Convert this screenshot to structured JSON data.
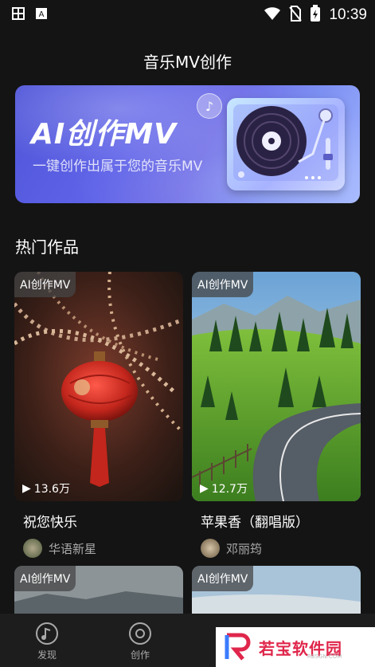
{
  "status_bar": {
    "time": "10:39",
    "icons": [
      "app-icon",
      "text-a-icon",
      "wifi-icon",
      "no-sim-icon",
      "battery-charging-icon"
    ]
  },
  "header": {
    "title": "音乐MV创作"
  },
  "banner": {
    "title": "AI创作MV",
    "subtitle": "一键创作出属于您的音乐MV"
  },
  "section": {
    "title": "热门作品"
  },
  "works": [
    {
      "tag": "AI创作MV",
      "plays": "13.6万",
      "song": "祝您快乐",
      "artist": "华语新星"
    },
    {
      "tag": "AI创作MV",
      "plays": "12.7万",
      "song": "苹果香（翻唱版）",
      "artist": "邓丽筠"
    },
    {
      "tag": "AI创作MV"
    },
    {
      "tag": "AI创作MV"
    }
  ],
  "tabbar": {
    "tabs": [
      {
        "label": "发现",
        "icon": "music-note-icon"
      },
      {
        "label": "创作",
        "icon": "record-icon"
      }
    ]
  },
  "watermark": {
    "text": "若宝软件园",
    "small": "RBSGN.COM"
  }
}
